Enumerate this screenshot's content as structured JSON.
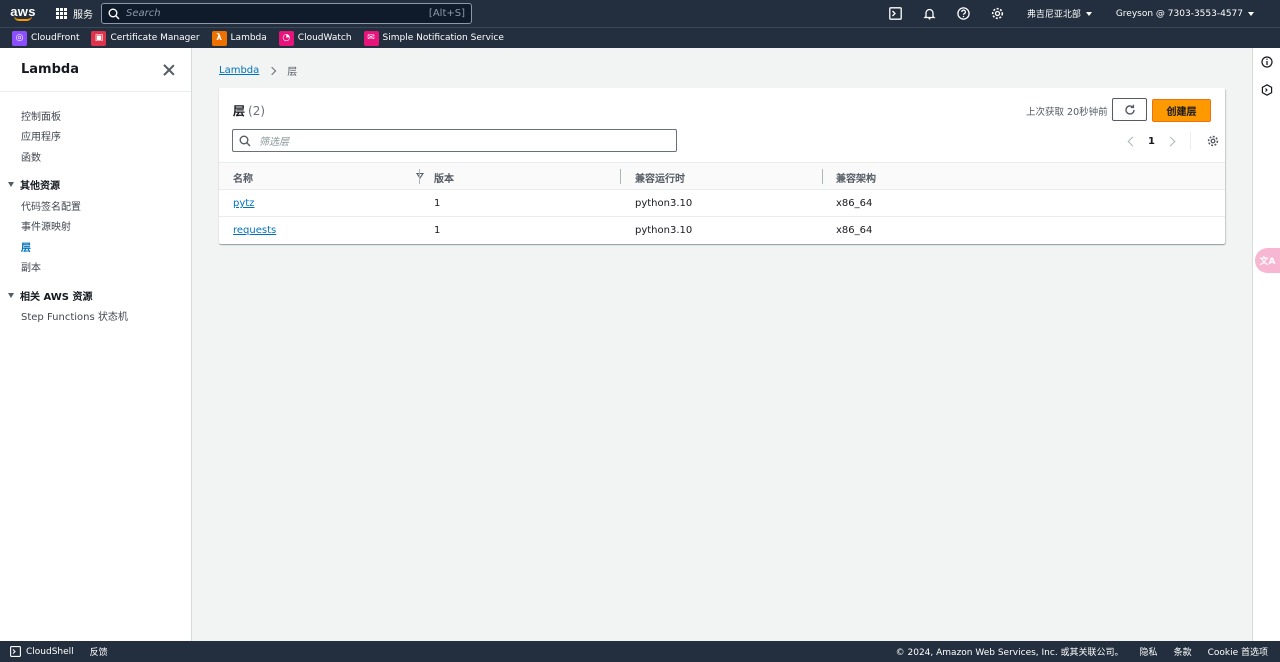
{
  "topnav": {
    "logo": "aws",
    "services_label": "服务",
    "search_placeholder": "Search",
    "search_shortcut": "[Alt+S]",
    "region": "弗吉尼亚北部",
    "account": "Greyson @ 7303-3553-4577",
    "icons": [
      "cloudshell-icon",
      "bell-icon",
      "help-icon",
      "settings-icon"
    ]
  },
  "favorites": [
    {
      "label": "CloudFront",
      "icon": "cloudfront-icon",
      "color": "#8c4fff"
    },
    {
      "label": "Certificate Manager",
      "icon": "certificate-manager-icon",
      "color": "#dd344c"
    },
    {
      "label": "Lambda",
      "icon": "lambda-icon",
      "color": "#ed7100"
    },
    {
      "label": "CloudWatch",
      "icon": "cloudwatch-icon",
      "color": "#e7157b"
    },
    {
      "label": "Simple Notification Service",
      "icon": "sns-icon",
      "color": "#e7157b"
    }
  ],
  "sidebar": {
    "title": "Lambda",
    "items": [
      {
        "label": "控制面板"
      },
      {
        "label": "应用程序"
      },
      {
        "label": "函数"
      }
    ],
    "section_other": "其他资源",
    "other_items": [
      {
        "label": "代码签名配置"
      },
      {
        "label": "事件源映射"
      },
      {
        "label": "层"
      },
      {
        "label": "副本"
      }
    ],
    "section_related": "相关 AWS 资源",
    "related_items": [
      {
        "label": "Step Functions 状态机"
      }
    ]
  },
  "breadcrumb": {
    "root": "Lambda",
    "current": "层"
  },
  "panel": {
    "title": "层",
    "count": "(2)",
    "last_fetch": "上次获取 20秒钟前",
    "create_label": "创建层",
    "filter_placeholder": "筛选层",
    "page": "1",
    "columns": [
      "名称",
      "版本",
      "兼容运行时",
      "兼容架构"
    ],
    "rows": [
      {
        "name": "pytz",
        "version": "1",
        "runtime": "python3.10",
        "arch": "x86_64"
      },
      {
        "name": "requests",
        "version": "1",
        "runtime": "python3.10",
        "arch": "x86_64"
      }
    ]
  },
  "footer": {
    "cloudshell": "CloudShell",
    "feedback": "反馈",
    "copyright": "© 2024, Amazon Web Services, Inc. 或其关联公司。",
    "privacy": "隐私",
    "terms": "条款",
    "cookie": "Cookie 首选项"
  },
  "colors": {
    "nav_bg": "#232f3e",
    "accent": "#ff9900",
    "link": "#0073bb"
  }
}
